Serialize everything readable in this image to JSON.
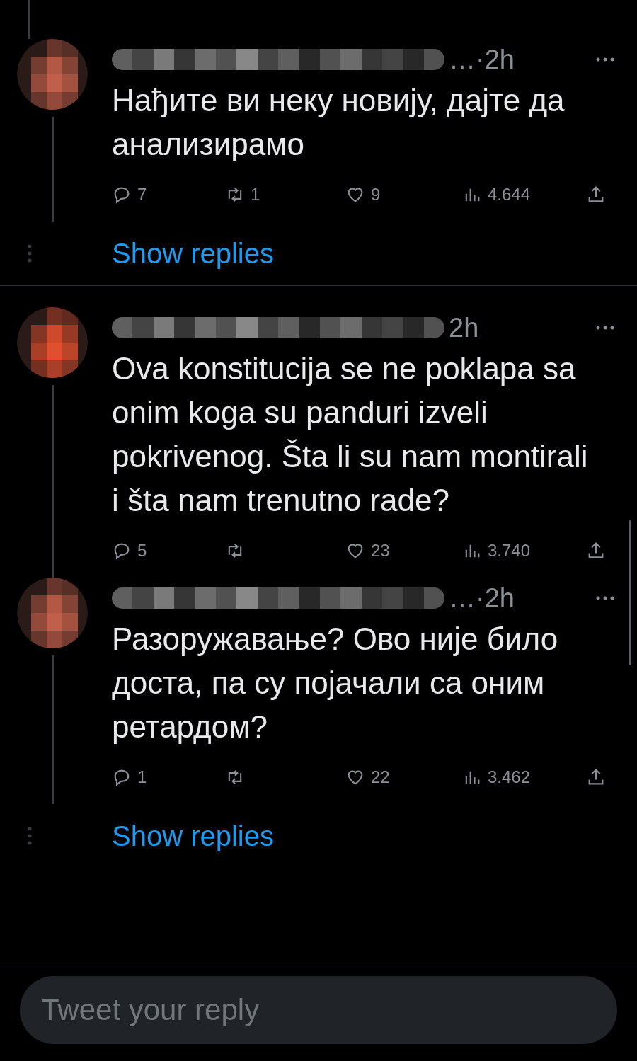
{
  "tweets": [
    {
      "time": "…·2h",
      "text": "Нађите ви неку новију, дајте да анализирамо",
      "replies": "7",
      "retweets": "1",
      "likes": "9",
      "views": "4.644",
      "show_replies": "Show replies"
    },
    {
      "time": "2h",
      "text": "Ova konstitucija se ne poklapa sa onim koga su panduri izveli pokrivenog. Šta li su nam montirali i šta nam trenutno rade?",
      "replies": "5",
      "likes": "23",
      "views": "3.740"
    },
    {
      "time": "…·2h",
      "text": "Разоружавање? Ово није било доста, па су појачали са оним ретардом?",
      "replies": "1",
      "likes": "22",
      "views": "3.462",
      "show_replies": "Show replies"
    }
  ],
  "composer": {
    "placeholder": "Tweet your reply"
  }
}
